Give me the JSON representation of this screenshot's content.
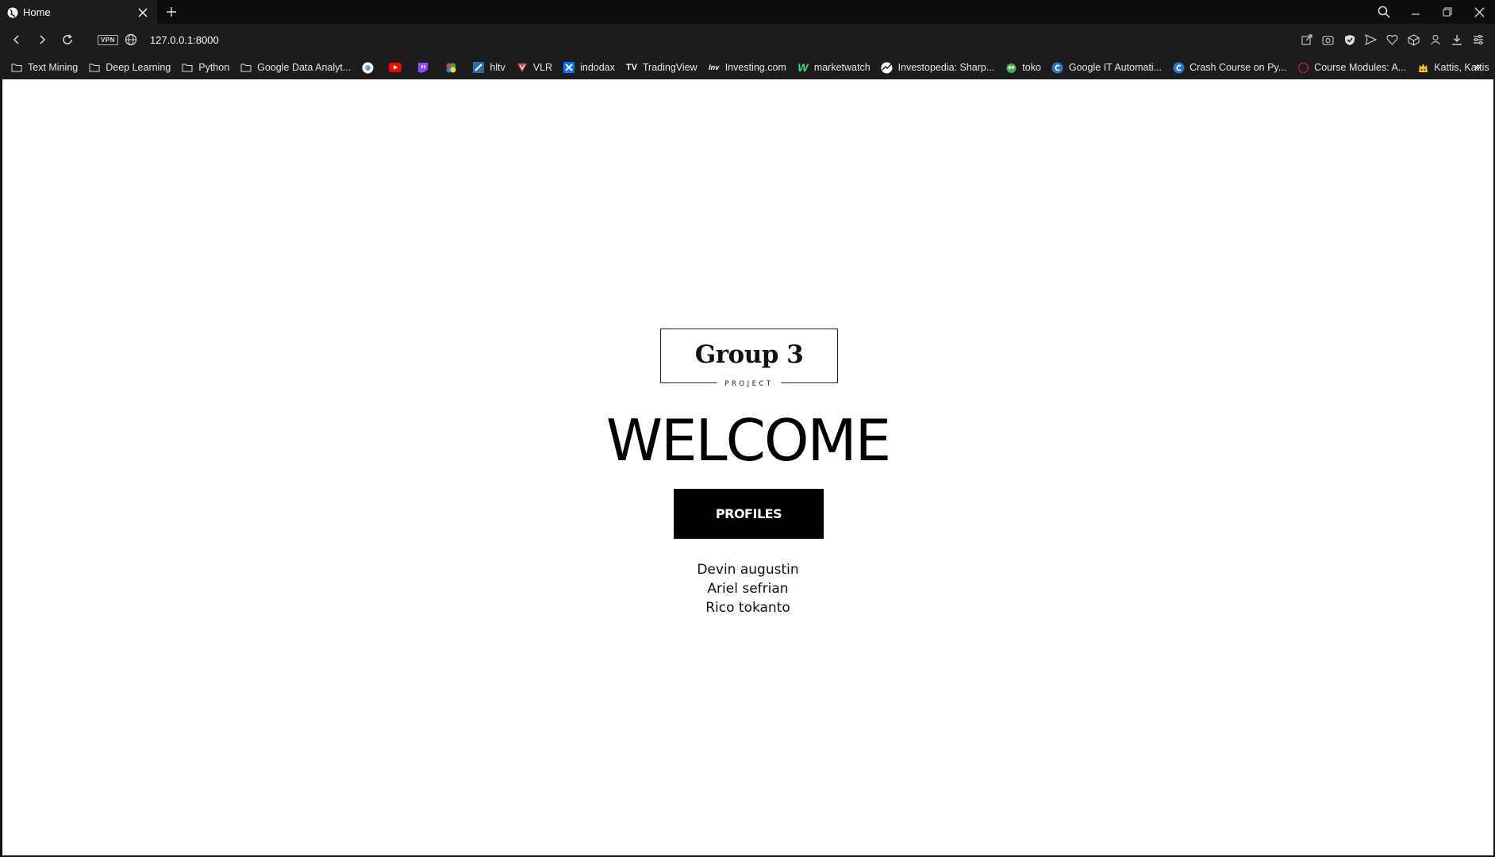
{
  "browser": {
    "tab_title": "Home",
    "url": "127.0.0.1:8000",
    "vpn_label": "VPN",
    "bookmarks": [
      {
        "label": "Text Mining",
        "icon": "folder-icon"
      },
      {
        "label": "Deep Learning",
        "icon": "folder-icon"
      },
      {
        "label": "Python",
        "icon": "folder-icon"
      },
      {
        "label": "Google Data Analyt...",
        "icon": "folder-icon"
      },
      {
        "label": "",
        "icon": "google-icon"
      },
      {
        "label": "",
        "icon": "youtube-icon"
      },
      {
        "label": "",
        "icon": "twitch-icon"
      },
      {
        "label": "",
        "icon": "colorful-app-icon"
      },
      {
        "label": "hltv",
        "icon": "hltv-icon"
      },
      {
        "label": "VLR",
        "icon": "vlr-icon"
      },
      {
        "label": "indodax",
        "icon": "indodax-icon"
      },
      {
        "label": "TradingView",
        "icon": "tradingview-icon"
      },
      {
        "label": "Investing.com",
        "icon": "investing-icon"
      },
      {
        "label": "marketwatch",
        "icon": "marketwatch-icon"
      },
      {
        "label": "Investopedia: Sharp...",
        "icon": "investopedia-icon"
      },
      {
        "label": "toko",
        "icon": "toko-icon"
      },
      {
        "label": "Google IT Automati...",
        "icon": "coursera-icon"
      },
      {
        "label": "Crash Course on Py...",
        "icon": "coursera-icon"
      },
      {
        "label": "Course Modules: A...",
        "icon": "course-modules-icon"
      },
      {
        "label": "Kattis, Kattis",
        "icon": "kattis-icon"
      }
    ],
    "more_bookmarks_label": "»"
  },
  "page": {
    "logo_title": "Group 3",
    "logo_subtitle": "PROJECT",
    "welcome": "WELCOME",
    "profiles_button": "PROFILES",
    "members": [
      "Devin augustin",
      "Ariel sefrian",
      "Rico tokanto"
    ]
  },
  "colors": {
    "chrome_dark": "#0d0d0d",
    "chrome_bar": "#1c1c1c",
    "page_bg": "#ffffff",
    "button_bg": "#000000",
    "text": "#111111"
  }
}
